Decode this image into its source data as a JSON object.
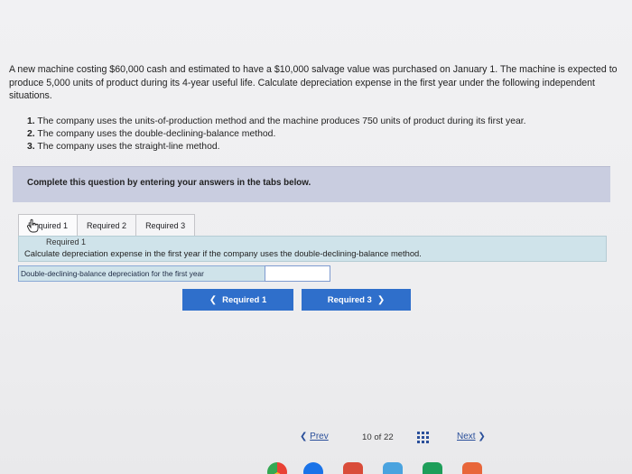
{
  "question": {
    "intro": "A new machine costing $60,000 cash and estimated to have a $10,000 salvage value was purchased on January 1. The machine is expected to produce 5,000 units of product during its 4-year useful life. Calculate depreciation expense in the first year under the following independent situations.",
    "tasks": [
      {
        "num": "1.",
        "text": "The company uses the units-of-production method and the machine produces 750 units of product during its first year."
      },
      {
        "num": "2.",
        "text": "The company uses the double-declining-balance method."
      },
      {
        "num": "3.",
        "text": "The company uses the straight-line method."
      }
    ]
  },
  "banner": {
    "text": "Complete this question by entering your answers in the tabs below."
  },
  "tabs": [
    {
      "label": "Required 1",
      "active": true
    },
    {
      "label": "Required 2",
      "active": false
    },
    {
      "label": "Required 3",
      "active": false
    }
  ],
  "panel": {
    "tab_title": "Required 1",
    "instruction": "Calculate depreciation expense in the first year if the company uses the double-declining-balance method."
  },
  "answer": {
    "label": "Double-declining-balance depreciation for the first year",
    "value": ""
  },
  "nav": {
    "prev_label": "Required 1",
    "next_label": "Required 3"
  },
  "pager": {
    "prev": "Prev",
    "current": "10",
    "of": "of",
    "total": "22",
    "next": "Next"
  },
  "colors": {
    "accent": "#2f6fcb",
    "banner": "#c9cde0",
    "panel": "#cfe3ea",
    "link": "#2a4f9a"
  }
}
